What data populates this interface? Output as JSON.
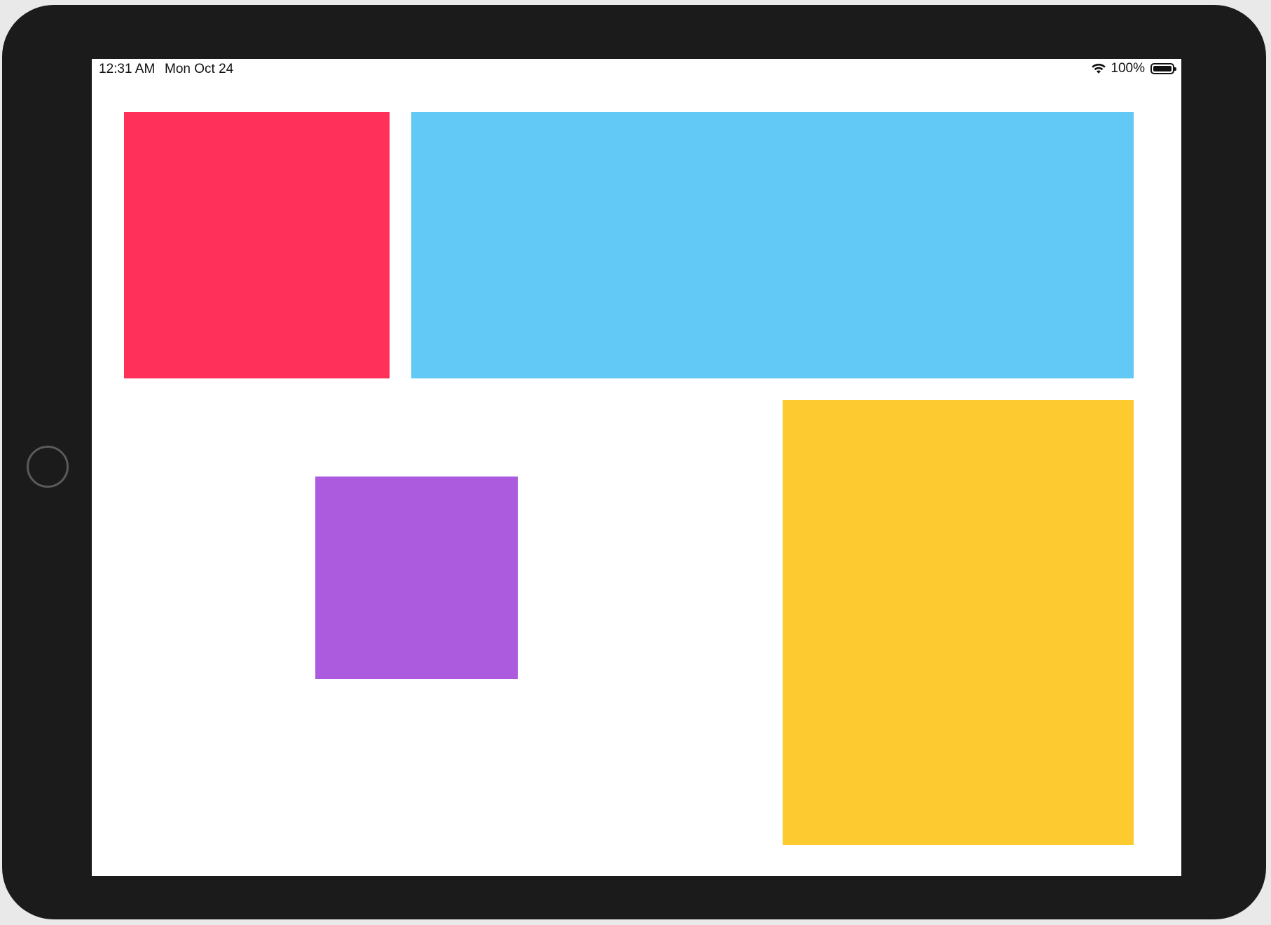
{
  "status_bar": {
    "time": "12:31 AM",
    "date": "Mon Oct 24",
    "battery_text": "100%",
    "battery_level": 1.0,
    "wifi_icon": "wifi-icon",
    "battery_icon": "battery-icon"
  },
  "blocks": [
    {
      "name": "red-block",
      "color": "#ff315b"
    },
    {
      "name": "blue-block",
      "color": "#62c8f6"
    },
    {
      "name": "purple-block",
      "color": "#ac5bde"
    },
    {
      "name": "yellow-block",
      "color": "#fdcb2f"
    }
  ],
  "device": {
    "bezel_color": "#1b1b1b",
    "screen_color": "#ffffff"
  }
}
